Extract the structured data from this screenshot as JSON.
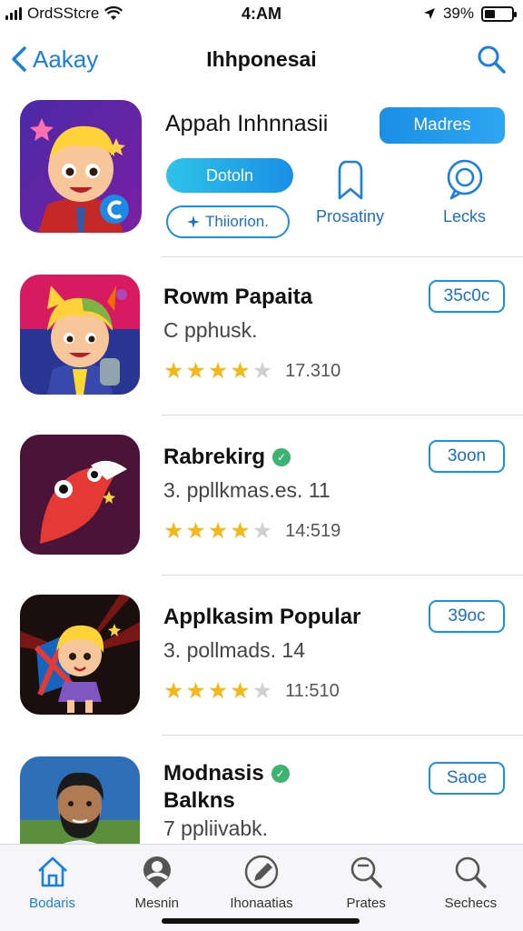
{
  "status_bar": {
    "carrier": "OrdSStcre",
    "time": "4:AM",
    "battery_percent": "39%",
    "battery_level": 0.39
  },
  "nav": {
    "back_label": "Aakay",
    "title": "Ihhponesai"
  },
  "featured": {
    "title": "Appah Inhnnasii",
    "primary_button": "Madres",
    "pill_button": "Dotoln",
    "outline_button": "Thiiorion.",
    "actions": [
      {
        "label": "Prosatiny",
        "icon": "bookmark-icon"
      },
      {
        "label": "Lecks",
        "icon": "chat-icon"
      }
    ]
  },
  "apps": [
    {
      "title": "Rowm Papaita",
      "subtitle": "C pphusk.",
      "rating_count": "17.310",
      "stars": 4,
      "button": "35c0c",
      "verified": false
    },
    {
      "title": "Rabrekirg",
      "subtitle": "3. ppllkmas.es.  11",
      "rating_count": "14:519",
      "stars": 4,
      "button": "3oon",
      "verified": true
    },
    {
      "title": "Applkasim Popular",
      "subtitle": "3. pollmads. 14",
      "rating_count": "11:510",
      "stars": 4,
      "button": "39oc",
      "verified": false
    },
    {
      "title": "Modnasis",
      "title2": "Balkns",
      "subtitle": "7 ppliivabk.",
      "button": "Saoe",
      "verified": true
    }
  ],
  "tabs": [
    {
      "label": "Bodaris",
      "icon": "home-icon",
      "active": true
    },
    {
      "label": "Mesnin",
      "icon": "profile-icon",
      "active": false
    },
    {
      "label": "Ihonaatias",
      "icon": "pencil-icon",
      "active": false
    },
    {
      "label": "Prates",
      "icon": "search-tag-icon",
      "active": false
    },
    {
      "label": "Sechecs",
      "icon": "search-icon",
      "active": false
    }
  ],
  "colors": {
    "accent": "#1a8fe6",
    "star": "#f3b818",
    "verified": "#3cb371"
  }
}
